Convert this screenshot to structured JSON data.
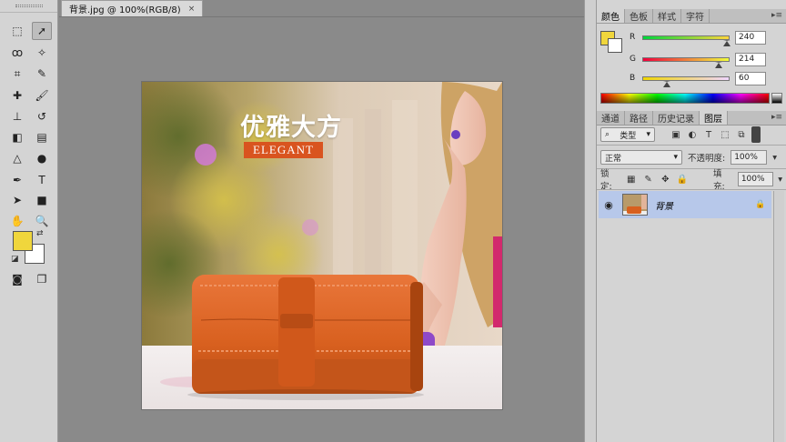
{
  "document": {
    "tab_title": "背景.jpg @ 100%(RGB/8)",
    "close_glyph": "×",
    "image": {
      "headline": "优雅大方",
      "subline": "ELEGANT"
    }
  },
  "tools": {
    "foreground_color": "#f0d63c",
    "background_color": "#ffffff"
  },
  "color_panel": {
    "tabs": [
      "颜色",
      "色板",
      "样式",
      "字符"
    ],
    "active_tab": "颜色",
    "channels": [
      {
        "label": "R",
        "value": "240",
        "fraction": 0.941,
        "gradient": [
          "#00d63c",
          "#ffd63c"
        ]
      },
      {
        "label": "G",
        "value": "214",
        "fraction": 0.839,
        "gradient": [
          "#f0003c",
          "#f0ff3c"
        ]
      },
      {
        "label": "B",
        "value": "60",
        "fraction": 0.235,
        "gradient": [
          "#f0d600",
          "#f0d6ff"
        ]
      }
    ]
  },
  "layers_panel": {
    "tabs": [
      "通道",
      "路径",
      "历史记录",
      "图层"
    ],
    "active_tab": "图层",
    "filter_kind": "类型",
    "blend_mode": "正常",
    "opacity_label": "不透明度:",
    "opacity_value": "100%",
    "lock_label": "锁定:",
    "fill_label": "填充:",
    "fill_value": "100%",
    "layers": [
      {
        "name": "背景",
        "visible": true,
        "locked": true,
        "selected": true
      }
    ]
  },
  "icons": {
    "panel_menu": "▸≡",
    "dropdown_arrow": "▾",
    "eye": "◉",
    "lock": "🔒"
  }
}
